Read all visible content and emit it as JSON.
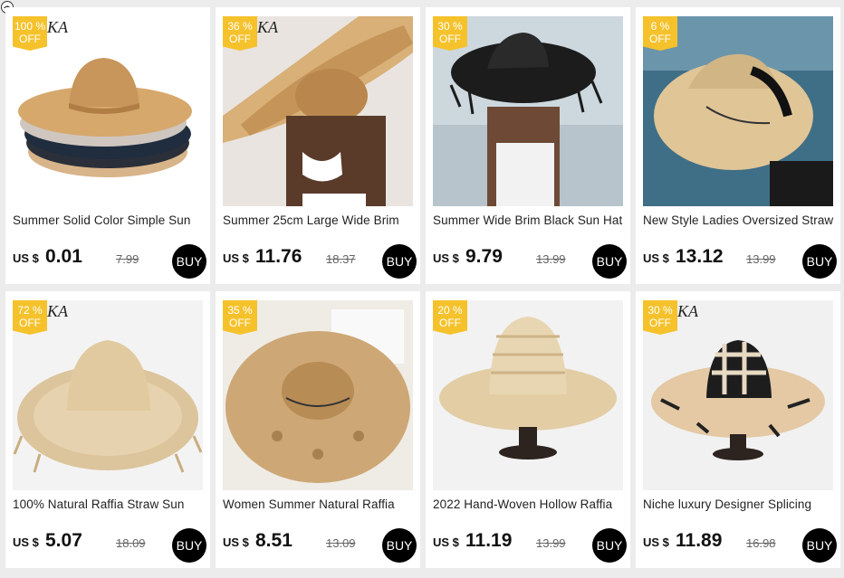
{
  "colors": {
    "badge": "#f5c22c",
    "buy": "#000000",
    "background": "#ececec"
  },
  "corner_icon": "circle-logo-icon",
  "products": [
    {
      "discount": "100 %",
      "off": "OFF",
      "brand": "KA",
      "title": "Summer Solid Color Simple Sun",
      "currency": "US $",
      "price": "0.01",
      "original": "7.99",
      "buy": "BUY",
      "image": "stacked-straw-hats"
    },
    {
      "discount": "36 %",
      "off": "OFF",
      "brand": "KA",
      "title": "Summer 25cm Large Wide Brim",
      "currency": "US $",
      "price": "11.76",
      "original": "18.37",
      "buy": "BUY",
      "image": "woman-large-straw-hat"
    },
    {
      "discount": "30 %",
      "off": "OFF",
      "brand": "",
      "title": "Summer Wide Brim Black Sun Hat",
      "currency": "US $",
      "price": "9.79",
      "original": "13.99",
      "buy": "BUY",
      "image": "black-sun-hat"
    },
    {
      "discount": "6 %",
      "off": "OFF",
      "brand": "",
      "title": "New Style Ladies Oversized Straw",
      "currency": "US $",
      "price": "13.12",
      "original": "13.99",
      "buy": "BUY",
      "image": "sun-please-hat"
    },
    {
      "discount": "72 %",
      "off": "OFF",
      "brand": "KA",
      "title": "100% Natural Raffia Straw Sun",
      "currency": "US $",
      "price": "5.07",
      "original": "18.09",
      "buy": "BUY",
      "image": "raffia-straw-hat"
    },
    {
      "discount": "35 %",
      "off": "OFF",
      "brand": "",
      "title": "Women Summer Natural Raffia",
      "currency": "US $",
      "price": "8.51",
      "original": "13.09",
      "buy": "BUY",
      "image": "woven-raffia-hat"
    },
    {
      "discount": "20 %",
      "off": "OFF",
      "brand": "",
      "title": "2022 Hand-Woven Hollow Raffia",
      "currency": "US $",
      "price": "11.19",
      "original": "13.99",
      "buy": "BUY",
      "image": "hollow-raffia-hat"
    },
    {
      "discount": "30 %",
      "off": "OFF",
      "brand": "KA",
      "title": "Niche luxury Designer Splicing",
      "currency": "US $",
      "price": "11.89",
      "original": "16.98",
      "buy": "BUY",
      "image": "splicing-designer-hat"
    }
  ]
}
